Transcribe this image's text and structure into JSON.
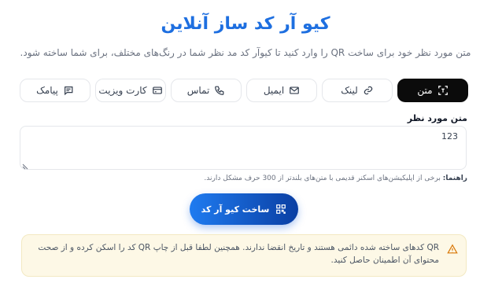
{
  "page": {
    "title": "کیو آر کد ساز آنلاین",
    "subtitle": "متن مورد نظر خود برای ساخت QR را وارد کنید تا کیوآر کد مد نظر شما در رنگ‌های مختلف، برای شما ساخته شود."
  },
  "tabs": [
    {
      "label": "متن",
      "icon": "text-scan-icon",
      "active": true
    },
    {
      "label": "لینک",
      "icon": "link-icon",
      "active": false
    },
    {
      "label": "ایمیل",
      "icon": "mail-icon",
      "active": false
    },
    {
      "label": "تماس",
      "icon": "phone-icon",
      "active": false
    },
    {
      "label": "کارت ویزیت",
      "icon": "card-icon",
      "active": false
    },
    {
      "label": "پیامک",
      "icon": "message-icon",
      "active": false
    }
  ],
  "form": {
    "field_label": "متن مورد نظر",
    "value": "123",
    "hint_label": "راهنما:",
    "hint_text": "برخی از اپلیکیشن‌های اسکنر قدیمی با متن‌های بلندتر از 300 حرف مشکل دارند."
  },
  "actions": {
    "build_label": "ساخت کیو آر کد"
  },
  "notice": {
    "text": "QR کدهای ساخته شده دائمی هستند و تاریخ انقضا ندارند. همچنین لطفا قبل از چاپ QR کد را اسکن کرده و از صحت محتوای آن اطمینان حاصل کنید."
  },
  "colors": {
    "accent": "#1e6fe0",
    "active_tab": "#0b0b0b",
    "notice_bg": "#fdf8e6",
    "warning": "#d97706"
  }
}
